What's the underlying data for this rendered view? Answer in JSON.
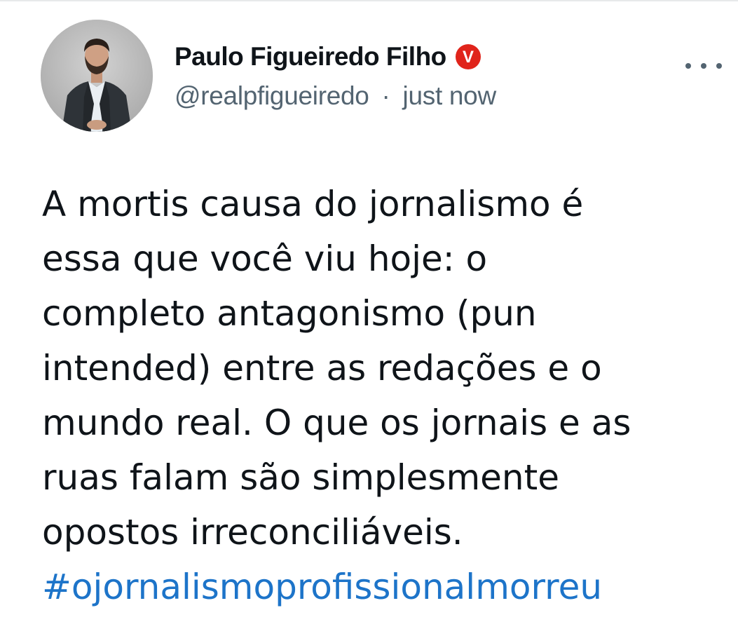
{
  "author": {
    "display_name": "Paulo Figueiredo Filho",
    "handle": "@realpfigueiredo",
    "separator": "·",
    "timestamp": "just now",
    "verified_badge_letter": "V",
    "verified_badge_color": "#e0241b"
  },
  "tweet": {
    "lines": [
      "A mortis causa do jornalismo é",
      "essa que você viu hoje: o",
      "completo antagonismo (pun",
      "intended) entre as redações e o",
      "mundo real. O que os jornais e as",
      "ruas falam são simplesmente",
      "opostos irreconciliáveis."
    ],
    "hashtag": "#ojornalismoprofissionalmorreu",
    "hashtag_color": "#1d74c9"
  },
  "icons": {
    "more": "more-options-icon",
    "verified": "verified-badge-icon"
  }
}
